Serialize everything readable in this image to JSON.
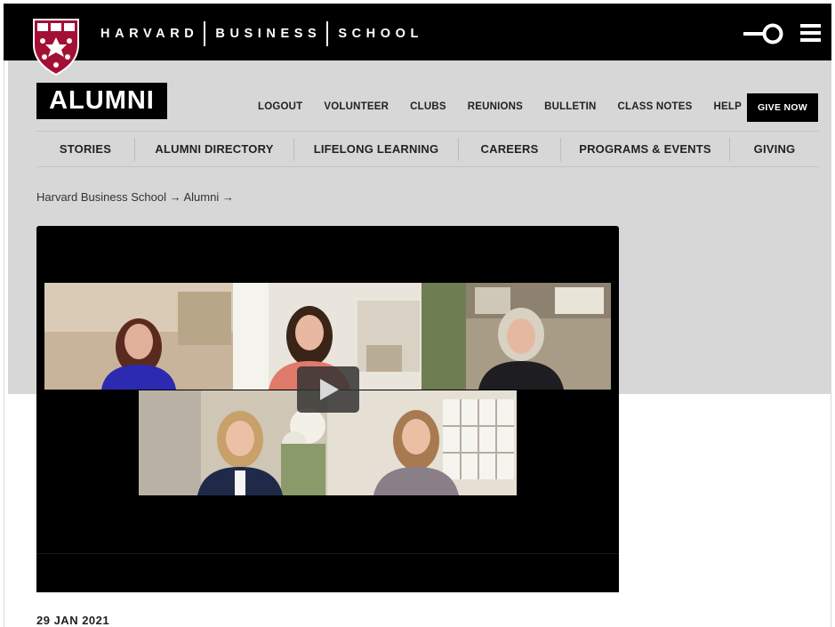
{
  "header": {
    "wordmark": [
      "HARVARD",
      "BUSINESS",
      "SCHOOL"
    ],
    "logo_icon": "hbs-shield-icon",
    "search_icon": "search-toggle-icon",
    "menu_icon": "hamburger-menu-icon"
  },
  "section_badge": "ALUMNI",
  "utility_nav": [
    "LOGOUT",
    "VOLUNTEER",
    "CLUBS",
    "REUNIONS",
    "BULLETIN",
    "CLASS NOTES",
    "HELP"
  ],
  "give_button": "GIVE NOW",
  "main_nav": [
    "STORIES",
    "ALUMNI DIRECTORY",
    "LIFELONG LEARNING",
    "CAREERS",
    "PROGRAMS & EVENTS",
    "GIVING"
  ],
  "breadcrumb": "Harvard Business School → Alumni →",
  "video": {
    "play_icon": "play-icon",
    "participants": 5
  },
  "article_date": "29 JAN 2021",
  "colors": {
    "header_bg": "#000000",
    "band_bg": "#d7d7d7",
    "crimson": "#a41034"
  }
}
